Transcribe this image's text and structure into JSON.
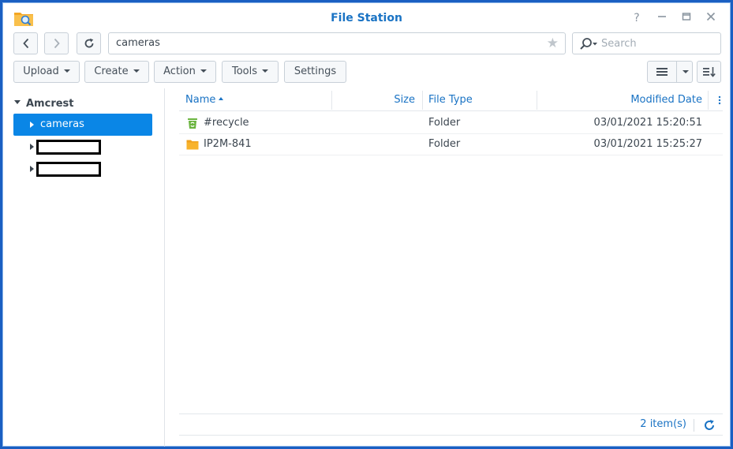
{
  "window": {
    "title": "File Station",
    "controls": [
      "help-icon",
      "minimize-icon",
      "maximize-icon",
      "close-icon"
    ]
  },
  "nav": {
    "back_icon": "chevron-left-icon",
    "forward_icon": "chevron-right-icon",
    "refresh_icon": "refresh-icon",
    "path": "cameras",
    "favorite_icon": "star-icon"
  },
  "search": {
    "placeholder": "Search",
    "icon": "search-icon"
  },
  "toolbar": {
    "upload": "Upload",
    "create": "Create",
    "action": "Action",
    "tools": "Tools",
    "settings": "Settings"
  },
  "tree": {
    "root": "Amcrest",
    "items": [
      {
        "label": "cameras",
        "selected": true
      },
      {
        "label": "",
        "redacted": true
      },
      {
        "label": "",
        "redacted": true
      }
    ]
  },
  "list": {
    "columns": {
      "name": "Name",
      "size": "Size",
      "type": "File Type",
      "modified": "Modified Date"
    },
    "rows": [
      {
        "icon": "recycle-bin-icon",
        "name": "#recycle",
        "size": "",
        "type": "Folder",
        "modified": "03/01/2021 15:20:51"
      },
      {
        "icon": "folder-icon",
        "name": "IP2M-841",
        "size": "",
        "type": "Folder",
        "modified": "03/01/2021 15:25:27"
      }
    ]
  },
  "footer": {
    "count": "2 item(s)"
  },
  "colors": {
    "accent": "#1a73c4",
    "selection": "#0a86e6",
    "folder": "#f5a623",
    "recycle": "#6ab43e"
  }
}
